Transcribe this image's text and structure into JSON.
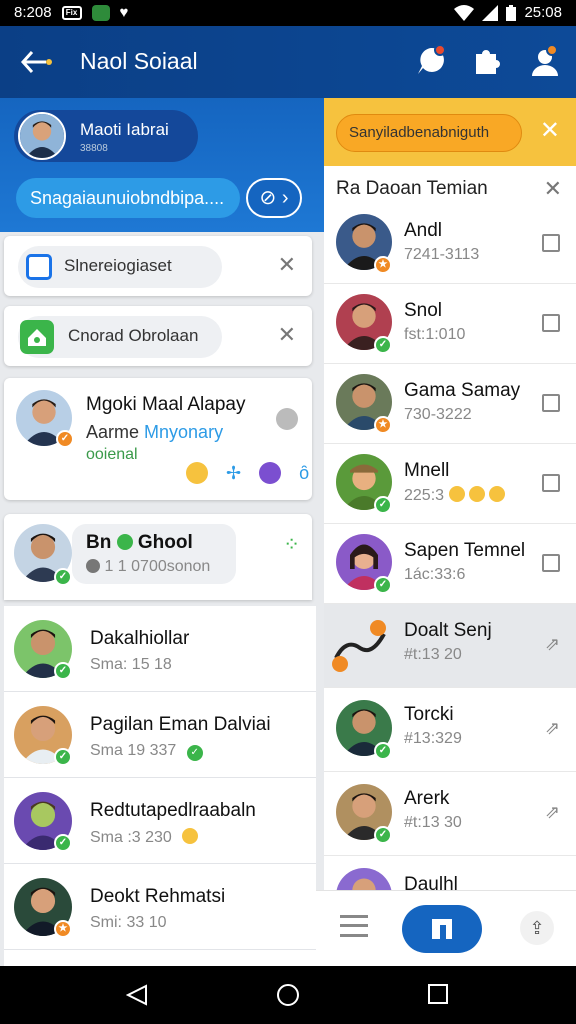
{
  "status_bar": {
    "time": "8:208",
    "box_label": "Fix",
    "right_time": "25:08"
  },
  "app_bar": {
    "title": "Naol Soiaal",
    "back_icon": "arrow-left-icon"
  },
  "user": {
    "name": "Maoti Iabrai",
    "sub": "38808"
  },
  "search": {
    "placeholder": "Snagaiaunuiobndbipa...."
  },
  "notifications": [
    {
      "label": "Slnereiogiaset",
      "icon": "calendar-icon",
      "color": "#1a73e8"
    },
    {
      "label": "Cnorad Obrolaan",
      "icon": "home-shield-icon",
      "color": "#3bb54a"
    }
  ],
  "featured": {
    "name": "Mgoki Maal Alapay",
    "line1": "Aarme",
    "line1_accent": "Mnyonary",
    "line2": "ooienal"
  },
  "group": {
    "name": "Bn",
    "name2": "Ghool",
    "sub": "1 1 0700sonon"
  },
  "contacts": [
    {
      "name": "Dakalhiollar",
      "sub": "Sma: 15 18",
      "badge": "check",
      "emoji": ""
    },
    {
      "name": "Pagilan Eman Dalviai",
      "sub": "Sma 19 337",
      "badge": "check",
      "emoji": "check"
    },
    {
      "name": "Redtutapedlraabaln",
      "sub": "Sma :3  230",
      "badge": "check",
      "emoji": "smile"
    },
    {
      "name": "Deokt Rehmatsi",
      "sub": "Smi: 33 10",
      "badge": "star",
      "emoji": ""
    }
  ],
  "right_panel": {
    "pill": "Sanyiladbenabniguth",
    "title": "Ra Daoan Temian",
    "suggestions": [
      {
        "name": "Andl",
        "sub": "7241-3113",
        "badge": "star",
        "action": "checkbox"
      },
      {
        "name": "Snol",
        "sub": "fst:1:010",
        "badge": "check",
        "action": "checkbox"
      },
      {
        "name": "Gama Samay",
        "sub": "730-3222",
        "badge": "star",
        "action": "checkbox"
      },
      {
        "name": "Mnell",
        "sub": "225:3",
        "badge": "check",
        "action": "checkbox"
      },
      {
        "name": "Sapen Temnel",
        "sub": "1ác:33:6",
        "badge": "check",
        "action": "checkbox"
      }
    ],
    "shared": [
      {
        "name": "Doalt Senj",
        "sub": "#t:13 20",
        "badge": "star",
        "action": "share"
      },
      {
        "name": "Torcki",
        "sub": "#13:329",
        "badge": "check",
        "action": "share"
      },
      {
        "name": "Arerk",
        "sub": "#t:13 30",
        "badge": "check",
        "action": "share"
      },
      {
        "name": "Daulhl",
        "sub": "",
        "badge": "check",
        "action": "share"
      }
    ]
  },
  "colors": {
    "primary": "#0d4a98",
    "accent": "#2d9be6",
    "yellow": "#f6c23e",
    "green": "#3bb54a",
    "orange": "#f08a24"
  }
}
